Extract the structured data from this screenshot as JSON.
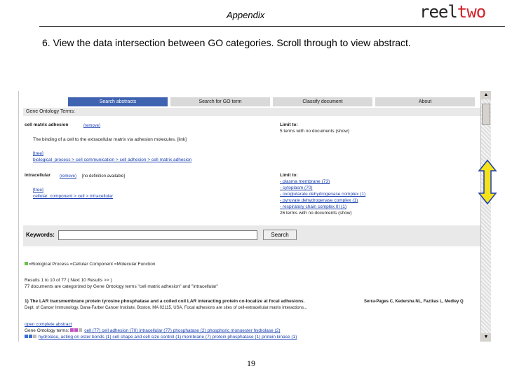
{
  "header": {
    "title": "Appendix",
    "logo_reel": "reel",
    "logo_two": "two"
  },
  "instruction": "6. View the data intersection between GO categories.  Scroll through to view abstract.",
  "tabs": [
    "Search abstracts",
    "Search for GO term",
    "Classify document",
    "About"
  ],
  "section_title": "Gene Ontology Terms:",
  "term1": {
    "name": "cell matrix adhesion",
    "remove": "(remove)",
    "definition": "The binding of a cell to the extracellular matrix via adhesion molecules. [link]",
    "tree_link": "[tree]",
    "path": "biological_process > cell communication > cell adhesion > cell matrix adhesion",
    "limit_label": "Limit to:",
    "limit_text": "5 terms with no documents (show)"
  },
  "term2": {
    "name": "intracellular",
    "remove": "(remove)",
    "definition": "[no definition available]",
    "tree_link": "[tree]",
    "path": "cellular_component > cell > intracellular",
    "limit_label": "Limit to:",
    "limit_items": [
      "- plasma membrane (73)",
      "- cytoplasm (70)",
      "- oxoglutarate dehydrogenase complex (1)",
      "- pyruvate dehydrogenase complex (1)",
      "- respiratory chain complex III (1)",
      "26 terms with no documents (show)"
    ]
  },
  "keywords": {
    "label": "Keywords:",
    "value": "",
    "button": "Search"
  },
  "legend": "=Biological Process  =Cellular Component  =Molecular Function",
  "results": {
    "line1": "Results 1 to 10 of 77 ( Next 10 Results >> )",
    "line2": "77 documents are categorized by Gene Ontology terms \"cell matrix adhesion\" and \"intracellular\""
  },
  "abstract": {
    "title": "1) The LAR transmembrane protein tyrosine phosphatase and a coiled coil LAR interacting protein co-localize at focal adhesions.",
    "authors": "Serra-Pages C, Kedersha NL, Fazikas L, Medley Q",
    "journal": "Dept. of Cancer Immunology, Dana-Farber Cancer Institute, Boston, MA 02115, USA. Focal adhesions are sites of cell-extracellular matrix interactions...",
    "open_link": "open complete abstract",
    "go_label": "Gene Ontology terms:",
    "go_row1": "cell (77)   cell adhesion (70)   intracellular (77)   phosphatase (2)   phosphoric monoester hydrolase (2)",
    "go_row2": "hydrolase, acting on ester bonds (1)   cell shape and cell size control (1)   membrane (7)   protein phosphatase (1)   protein kinase (1)"
  },
  "page_number": "19",
  "colors": {
    "tab_active": "#3f63b0",
    "logo_accent": "#d2232a",
    "arrow_fill": "#f5e21a",
    "arrow_stroke": "#1a3fb0"
  }
}
